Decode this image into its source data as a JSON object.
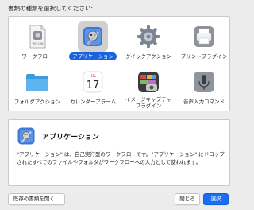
{
  "dialog": {
    "prompt": "書類の種類を選択してください:"
  },
  "types": [
    {
      "label": "ワークフロー",
      "icon": "workflow-document-icon",
      "badge": "WFLOW",
      "selected": false
    },
    {
      "label": "アプリケーション",
      "icon": "automator-robot-icon",
      "selected": true
    },
    {
      "label": "クイックアクション",
      "icon": "gear-icon",
      "selected": false
    },
    {
      "label": "プリントプラグイン",
      "icon": "printer-icon",
      "selected": false
    },
    {
      "label": "フォルダアクション",
      "icon": "folder-icon",
      "selected": false
    },
    {
      "label": "カレンダーアラーム",
      "icon": "calendar-icon",
      "month": "JUL",
      "day": "17",
      "selected": false
    },
    {
      "label": "イメージキャプチャ",
      "label2": "プラグイン",
      "icon": "image-capture-icon",
      "selected": false
    },
    {
      "label": "音声入力コマンド",
      "icon": "microphone-icon",
      "selected": false
    }
  ],
  "description": {
    "title": "アプリケーション",
    "text": "\"アプリケーション\" は、自己実行型のワークフローです。\"アプリケーション\" にドロップされたすべてのファイルやフォルダがワークフローへの入力として使われます。"
  },
  "buttons": {
    "open_existing": "既存の書類を開く...",
    "close": "閉じる",
    "choose": "選択"
  },
  "colors": {
    "accent": "#1a6ef5",
    "selection": "#1862dd"
  }
}
